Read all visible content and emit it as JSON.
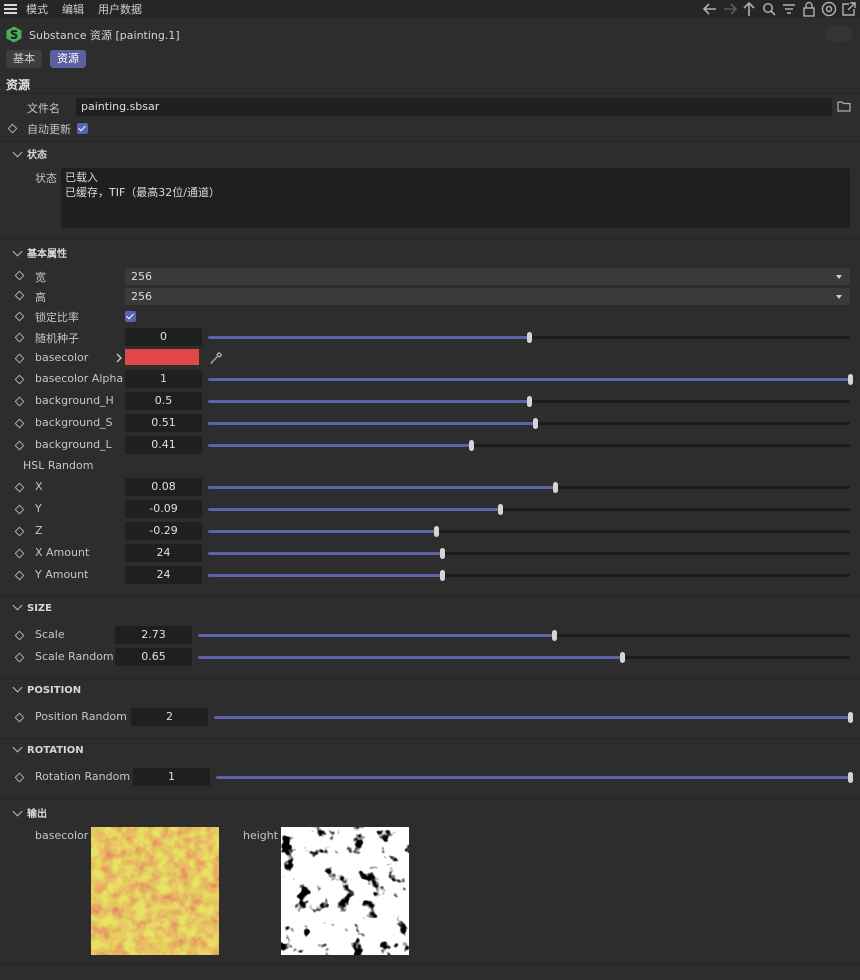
{
  "menubar": {
    "items": [
      "模式",
      "编辑",
      "用户数据"
    ]
  },
  "title": {
    "text": "Substance 资源 [painting.1]"
  },
  "tabs": [
    {
      "label": "基本",
      "active": false
    },
    {
      "label": "资源",
      "active": true
    }
  ],
  "section": {
    "title": "资源"
  },
  "file": {
    "label": "文件名",
    "value": "painting.sbsar"
  },
  "auto_update": {
    "label": "自动更新",
    "checked": true
  },
  "status_group": {
    "title": "状态",
    "label": "状态",
    "lines": [
      "已载入",
      "已缓存，TIF（最高32位/通道）"
    ]
  },
  "basic_group": {
    "title": "基本属性",
    "width": {
      "label": "宽",
      "value": "256"
    },
    "height": {
      "label": "高",
      "value": "256"
    },
    "lock_ratio": {
      "label": "锁定比率",
      "checked": true
    },
    "seed": {
      "label": "随机种子",
      "value": "0",
      "fraction": 0.5
    },
    "basecolor": {
      "label": "basecolor",
      "color": "#e04848"
    },
    "basecolor_alpha": {
      "label": "basecolor Alpha",
      "value": "1",
      "fraction": 1.0
    },
    "bg_h": {
      "label": "background_H",
      "value": "0.5",
      "fraction": 0.5
    },
    "bg_s": {
      "label": "background_S",
      "value": "0.51",
      "fraction": 0.51
    },
    "bg_l": {
      "label": "background_L",
      "value": "0.41",
      "fraction": 0.41
    },
    "hsl_random": {
      "label": "HSL Random"
    },
    "x": {
      "label": "X",
      "value": "0.08",
      "fraction": 0.54
    },
    "y": {
      "label": "Y",
      "value": "-0.09",
      "fraction": 0.455
    },
    "z": {
      "label": "Z",
      "value": "-0.29",
      "fraction": 0.355
    },
    "x_amount": {
      "label": "X Amount",
      "value": "24",
      "fraction": 0.365
    },
    "y_amount": {
      "label": "Y Amount",
      "value": "24",
      "fraction": 0.365
    }
  },
  "size_group": {
    "title": "SIZE",
    "scale": {
      "label": "Scale",
      "value": "2.73",
      "fraction": 0.546
    },
    "scale_random": {
      "label": "Scale Random",
      "value": "0.65",
      "fraction": 0.65
    }
  },
  "position_group": {
    "title": "POSITION",
    "position_random": {
      "label": "Position Random",
      "value": "2",
      "fraction": 1.0
    }
  },
  "rotation_group": {
    "title": "ROTATION",
    "rotation_random": {
      "label": "Rotation Random",
      "value": "1",
      "fraction": 1.0
    }
  },
  "output_group": {
    "title": "输出",
    "outputs": [
      {
        "label": "basecolor"
      },
      {
        "label": "height"
      }
    ]
  },
  "colors": {
    "accent": "#5c63a8",
    "background": "#2d2d2d",
    "field": "#1f1f1f"
  }
}
